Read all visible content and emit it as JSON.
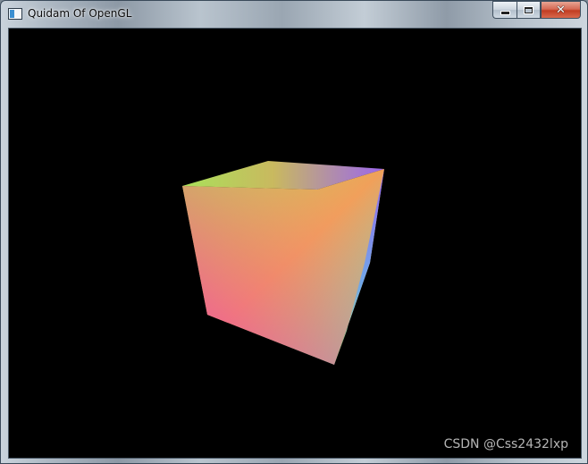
{
  "window": {
    "title": "Quidam Of OpenGL",
    "icon": "console-window-icon",
    "buttons": {
      "minimize_icon": "minimize-icon",
      "maximize_icon": "maximize-icon",
      "close_icon": "close-icon",
      "close_glyph": "✕"
    }
  },
  "viewport": {
    "background": "#000000",
    "scene": "rgb-color-cube",
    "vertex_colors": {
      "top_left": "#a8e35a",
      "top_center": "#7d86f0",
      "top_right": "#9a62ee",
      "left_bottom": "#ee4fa8",
      "bottom": "#4fe6e6",
      "right_lower": "#b3e86a",
      "front_center": "#f09a63"
    }
  },
  "watermark": {
    "text": "CSDN @Css2432lxp"
  }
}
